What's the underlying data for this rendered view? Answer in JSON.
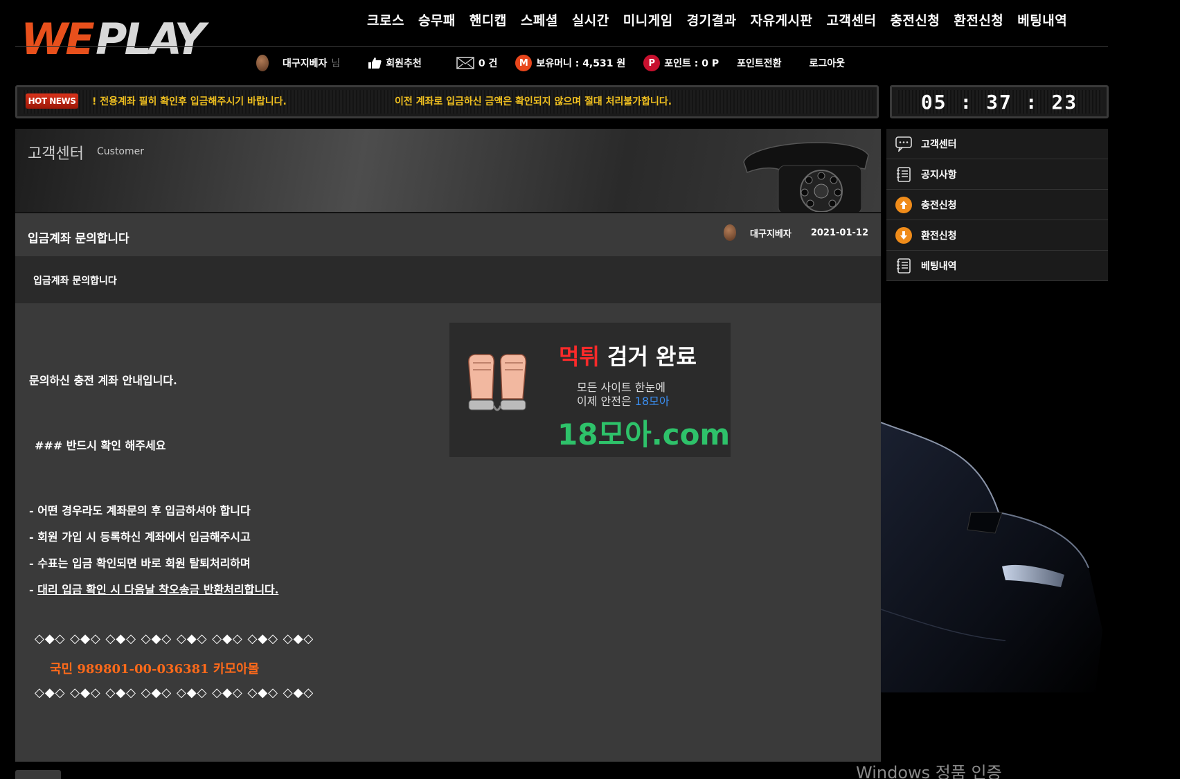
{
  "brand": {
    "logo_text_we": "WE",
    "logo_text_play": "PLAY",
    "accent": "#e8501c"
  },
  "nav": [
    "크로스",
    "승무패",
    "핸디캡",
    "스페셜",
    "실시간",
    "미니게임",
    "경기결과",
    "자유게시판",
    "고객센터",
    "충전신청",
    "환전신청",
    "베팅내역"
  ],
  "user": {
    "name": "대구지베자",
    "suffix": "님",
    "recommend": "회원추천",
    "messages": "0 건",
    "money_label": "보유머니 : 4,531 원",
    "points_label": "포인트 : 0 P",
    "convert": "포인트전환",
    "logout": "로그아웃"
  },
  "news": {
    "badge": "HOT NEWS",
    "text1": "! 전용계좌 필히 확인후 입금해주시기 바랍니다.",
    "text2": "이전 계좌로 입금하신 금액은 확인되지 않으며 절대 처리불가합니다."
  },
  "clock": "05 : 37 : 23",
  "banner": {
    "title": "고객센터",
    "subtitle": "Customer"
  },
  "post": {
    "title": "입금계좌 문의합니다",
    "author": "대구지베자",
    "date": "2021-01-12",
    "subject": "입금계좌 문의합니다",
    "body": {
      "l1": "문의하신 충전 계좌 안내입니다.",
      "l2": "### 반드시 확인 해주세요",
      "l3": "- 어떤 경우라도 계좌문의 후 입금하셔야 합니다",
      "l4": "- 회원 가입 시 등록하신 계좌에서 입금해주시고",
      "l5": "- 수표는 입금 확인되면 바로 회원 탈퇴처리하며",
      "l6_prefix": "- ",
      "l6_underlined": "대리 입금 확인 시 다음날 착오송금 반환처리합니다.",
      "diamonds": "◇◆◇ ◇◆◇ ◇◆◇ ◇◆◇ ◇◆◇ ◇◆◇ ◇◆◇ ◇◆◇",
      "account": "국민 989801-00-036381 카모아몰"
    }
  },
  "ad": {
    "title_red": "먹튀",
    "title_white": " 검거 완료",
    "line1": "모든 사이트 한눈에",
    "line2_prefix": "이제 안전은 ",
    "line2_blue": "18모아",
    "domain": "18모아.com"
  },
  "sidebar": [
    "고객센터",
    "공지사항",
    "충전신청",
    "환전신청",
    "베팅내역"
  ],
  "watermark": "Windows 정품 인증"
}
